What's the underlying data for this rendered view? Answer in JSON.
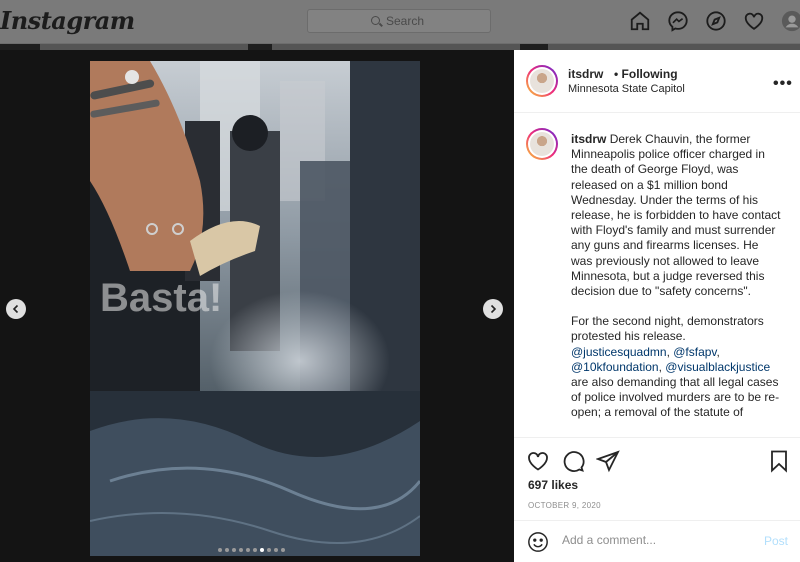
{
  "header": {
    "logo": "Instagram",
    "search_placeholder": "Search"
  },
  "post": {
    "username": "itsdrw",
    "following_label": "• Following",
    "location": "Minnesota State Capitol",
    "more_label": "•••",
    "caption_username": "itsdrw",
    "caption_p1": "Derek Chauvin, the former Minneapolis police officer charged in the death of George Floyd, was released on a $1 million bond Wednesday. Under the terms of his release, he is forbidden to have contact with Floyd's family and must surrender any guns and firearms licenses. He was previously not allowed to leave Minnesota, but a judge reversed this decision due to \"safety concerns\".",
    "caption_p2_start": "For the second night, demonstrators protested his release. ",
    "mention_1": "@justicesquadmn",
    "sep_1": ", ",
    "mention_2": "@fsfapv",
    "sep_2": ",",
    "mention_3": "@10kfoundation",
    "sep_3": ", ",
    "mention_4": "@visualblackjustice",
    "caption_p2_end": " are also demanding that all legal cases of police involved murders are to be re-open; a removal of the statute of",
    "likes": "697 likes",
    "date": "OCTOBER 9, 2020",
    "comment_placeholder": "Add a comment...",
    "post_label": "Post",
    "carousel": {
      "total": 10,
      "active_index": 6
    }
  },
  "colors": {
    "link": "#00376b",
    "post_button": "#b2dffc",
    "story_ring": [
      "#f9ce34",
      "#ee2a7b",
      "#6228d7"
    ]
  },
  "icons": [
    "search-icon",
    "home-icon",
    "messenger-icon",
    "explore-icon",
    "heart-icon",
    "profile-icon",
    "chevron-left-icon",
    "chevron-right-icon",
    "like-icon",
    "comment-icon",
    "share-icon",
    "bookmark-icon",
    "emoji-icon",
    "more-icon"
  ]
}
